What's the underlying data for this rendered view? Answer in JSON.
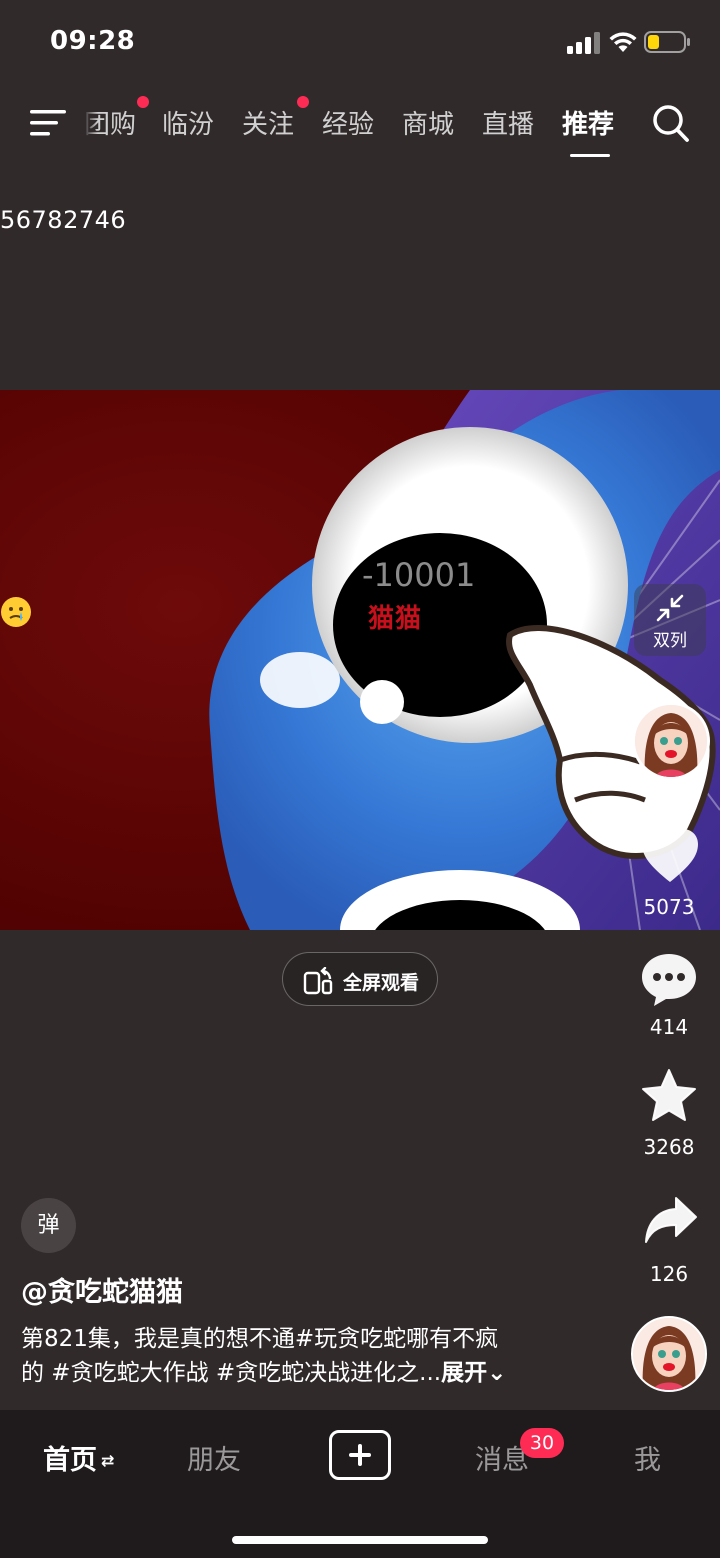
{
  "status_bar": {
    "time": "09:28"
  },
  "top_nav": {
    "tabs": [
      {
        "label": "团购",
        "dot": true
      },
      {
        "label": "临汾",
        "dot": false
      },
      {
        "label": "关注",
        "dot": true
      },
      {
        "label": "经验",
        "dot": false
      },
      {
        "label": "商城",
        "dot": false
      },
      {
        "label": "直播",
        "dot": false
      },
      {
        "label": "推荐",
        "dot": false,
        "active": true
      }
    ],
    "menu_icon": "menu-icon",
    "search_icon": "search-icon"
  },
  "user_id": "56782746",
  "video": {
    "code_text": "-10001",
    "caption_text": "猫猫",
    "emoji": "crying-smile-emoji",
    "double_col_label": "双列",
    "fullscreen_label": "全屏观看"
  },
  "actions": {
    "like_count": "5073",
    "comment_count": "414",
    "favorite_count": "3268",
    "share_count": "126"
  },
  "post": {
    "danmu_label": "弹",
    "author": "@贪吃蛇猫猫",
    "description_line1": "第821集，我是真的想不通#玩贪吃蛇哪有不疯",
    "description_line2": "的 #贪吃蛇大作战 #贪吃蛇决战进化之...",
    "expand_label": "展开"
  },
  "bottom_nav": {
    "home": "首页",
    "home_switch": "⇄",
    "friends": "朋友",
    "messages": "消息",
    "messages_badge": "30",
    "me": "我"
  },
  "colors": {
    "background": "#302a2b",
    "accent": "#fe2c55",
    "bottom_nav_bg": "#1f1b1c"
  }
}
